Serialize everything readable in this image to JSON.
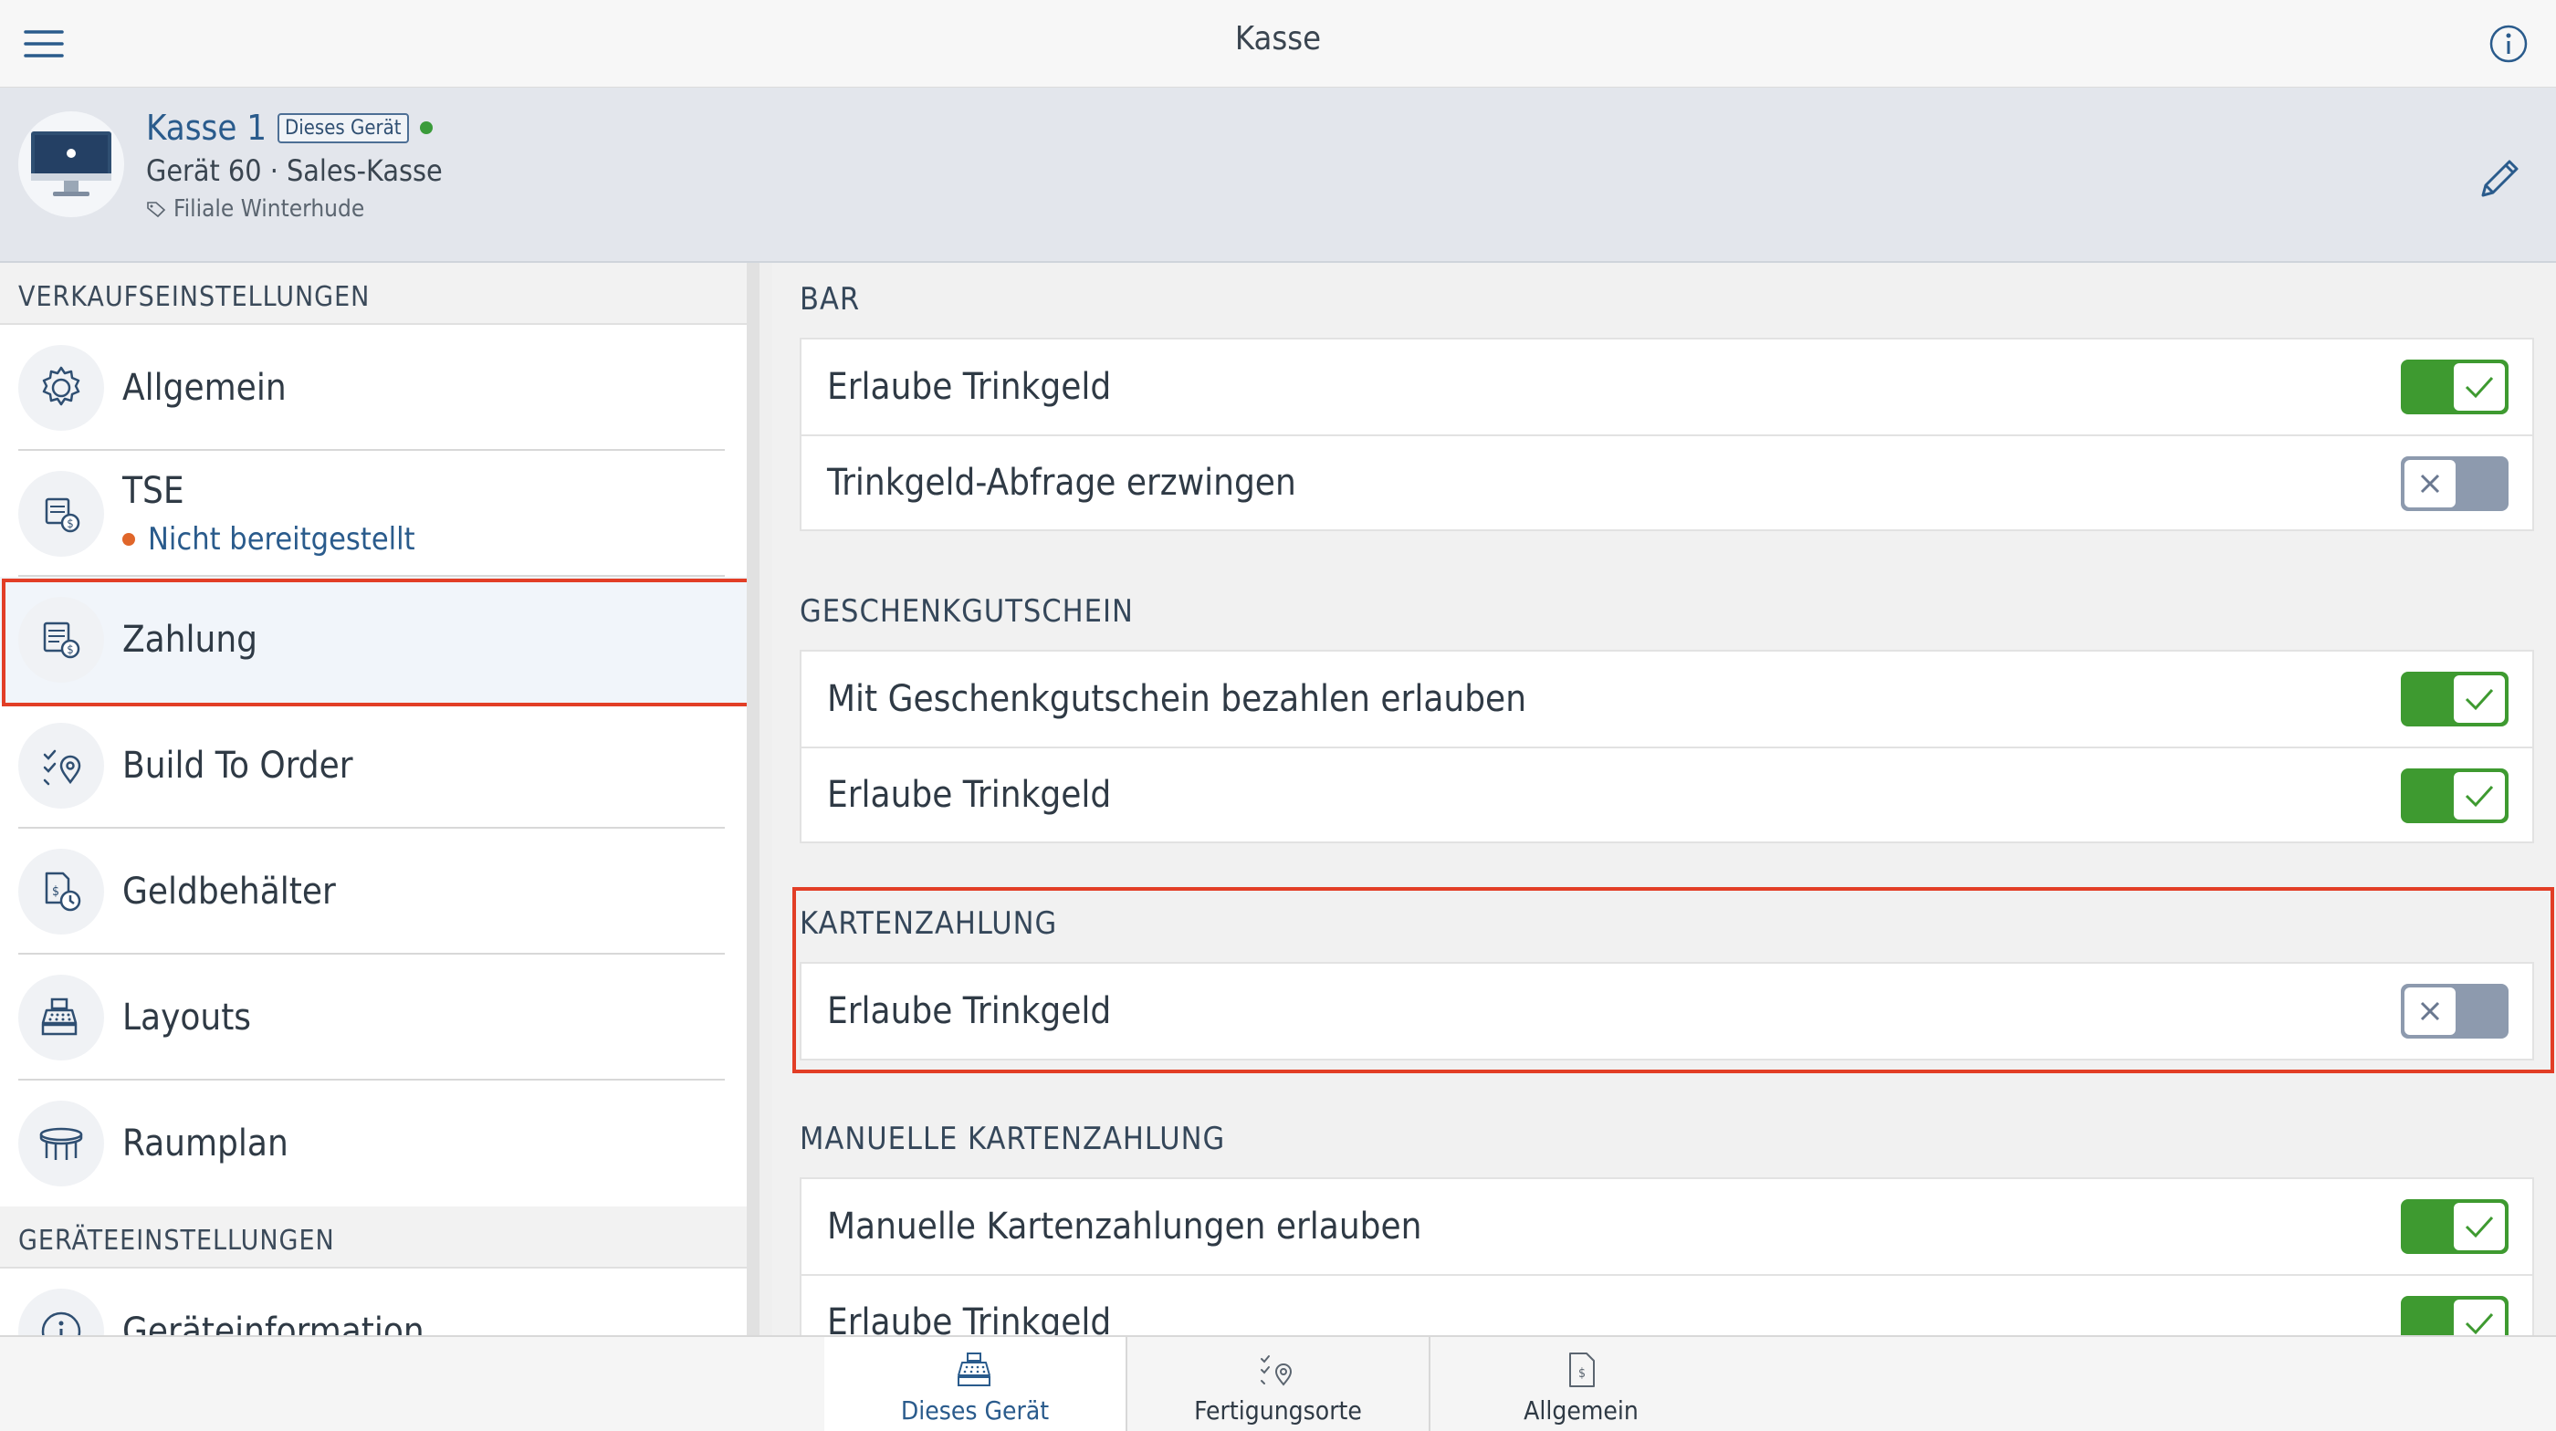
{
  "topbar": {
    "title": "Kasse"
  },
  "device": {
    "name": "Kasse 1",
    "badge": "Dieses Gerät",
    "status_color": "#3a9b3a",
    "subtitle": "Gerät 60 · Sales-Kasse",
    "location": "Filiale Winterhude"
  },
  "sidebar": {
    "section1": "VERKAUFSEINSTELLUNGEN",
    "items": [
      {
        "label": "Allgemein",
        "icon": "gear-icon"
      },
      {
        "label": "TSE",
        "status": "Nicht bereitgestellt",
        "icon": "tse-icon"
      },
      {
        "label": "Zahlung",
        "icon": "payment-icon",
        "selected": true
      },
      {
        "label": "Build To Order",
        "icon": "build-to-order-icon"
      },
      {
        "label": "Geldbehälter",
        "icon": "cash-container-icon"
      },
      {
        "label": "Layouts",
        "icon": "cash-register-icon"
      },
      {
        "label": "Raumplan",
        "icon": "table-icon"
      }
    ],
    "section2": "GERÄTEEINSTELLUNGEN",
    "items2": [
      {
        "label": "Geräteinformation",
        "icon": "info-icon"
      }
    ]
  },
  "groups": [
    {
      "title": "BAR",
      "rows": [
        {
          "label": "Erlaube Trinkgeld",
          "on": true
        },
        {
          "label": "Trinkgeld-Abfrage erzwingen",
          "on": false
        }
      ]
    },
    {
      "title": "GESCHENKGUTSCHEIN",
      "rows": [
        {
          "label": "Mit Geschenkgutschein bezahlen erlauben",
          "on": true
        },
        {
          "label": "Erlaube Trinkgeld",
          "on": true
        }
      ]
    },
    {
      "title": "KARTENZAHLUNG",
      "rows": [
        {
          "label": "Erlaube Trinkgeld",
          "on": false
        }
      ]
    },
    {
      "title": "MANUELLE KARTENZAHLUNG",
      "rows": [
        {
          "label": "Manuelle Kartenzahlungen erlauben",
          "on": true
        },
        {
          "label": "Erlaube Trinkgeld",
          "on": true
        }
      ]
    }
  ],
  "tabs": [
    {
      "label": "Dieses Gerät",
      "active": true
    },
    {
      "label": "Fertigungsorte",
      "active": false
    },
    {
      "label": "Allgemein",
      "active": false
    }
  ],
  "colors": {
    "accent": "#2a5b8c",
    "toggle_on": "#3e9a30",
    "toggle_off": "#8d9aae",
    "highlight": "#e23e26"
  }
}
